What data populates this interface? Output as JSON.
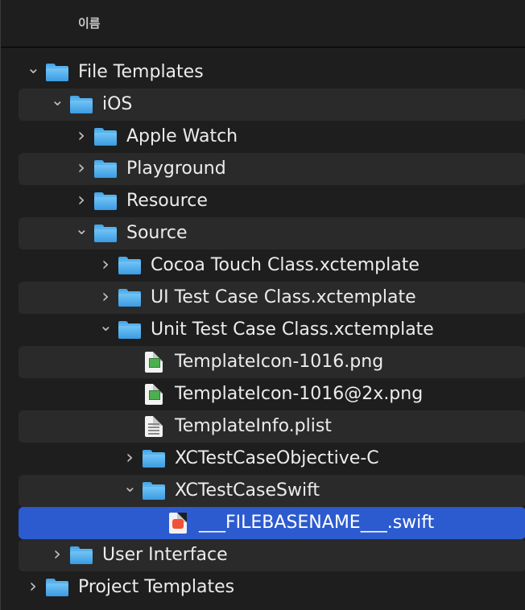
{
  "header": {
    "column_name": "이름"
  },
  "tree": [
    {
      "label": "File Templates",
      "kind": "folder",
      "expanded": true,
      "depth": 0,
      "alt": false
    },
    {
      "label": "iOS",
      "kind": "folder",
      "expanded": true,
      "depth": 1,
      "alt": true
    },
    {
      "label": "Apple Watch",
      "kind": "folder",
      "expanded": false,
      "depth": 2,
      "alt": false
    },
    {
      "label": "Playground",
      "kind": "folder",
      "expanded": false,
      "depth": 2,
      "alt": true
    },
    {
      "label": "Resource",
      "kind": "folder",
      "expanded": false,
      "depth": 2,
      "alt": false
    },
    {
      "label": "Source",
      "kind": "folder",
      "expanded": true,
      "depth": 2,
      "alt": true
    },
    {
      "label": "Cocoa Touch Class.xctemplate",
      "kind": "folder",
      "expanded": false,
      "depth": 3,
      "alt": false
    },
    {
      "label": "UI Test Case Class.xctemplate",
      "kind": "folder",
      "expanded": false,
      "depth": 3,
      "alt": true
    },
    {
      "label": "Unit Test Case Class.xctemplate",
      "kind": "folder",
      "expanded": true,
      "depth": 3,
      "alt": false
    },
    {
      "label": "TemplateIcon-1016.png",
      "kind": "png",
      "depth": 4,
      "alt": true
    },
    {
      "label": "TemplateIcon-1016@2x.png",
      "kind": "png",
      "depth": 4,
      "alt": false
    },
    {
      "label": "TemplateInfo.plist",
      "kind": "plist",
      "depth": 4,
      "alt": true
    },
    {
      "label": "XCTestCaseObjective-C",
      "kind": "folder",
      "expanded": false,
      "depth": 4,
      "alt": false
    },
    {
      "label": "XCTestCaseSwift",
      "kind": "folder",
      "expanded": true,
      "depth": 4,
      "alt": true
    },
    {
      "label": "___FILEBASENAME___.swift",
      "kind": "swift",
      "depth": 5,
      "selected": true
    },
    {
      "label": "User Interface",
      "kind": "folder",
      "expanded": false,
      "depth": 1,
      "alt": true
    },
    {
      "label": "Project Templates",
      "kind": "folder",
      "expanded": false,
      "depth": 0,
      "alt": false
    }
  ],
  "colors": {
    "selection": "#2c5bd0",
    "folder": "#4aa8e8",
    "background": "#1e1e1e"
  }
}
